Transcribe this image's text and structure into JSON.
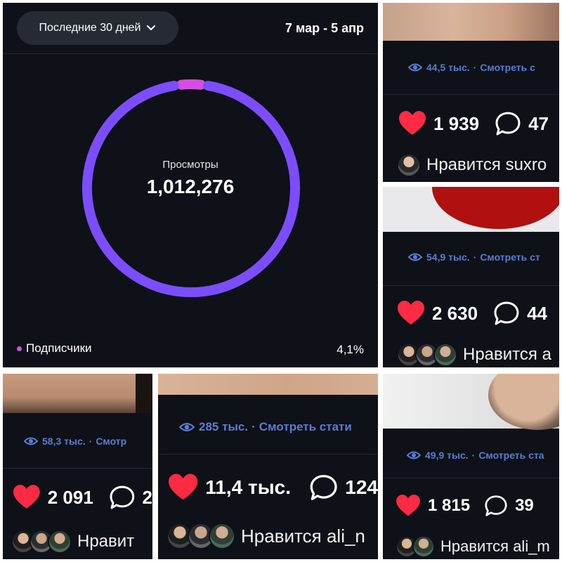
{
  "main": {
    "period_selector": "Последние 30 дней",
    "date_range": "7 мар - 5 апр",
    "ring_label": "Просмотры",
    "ring_value": "1,012,276",
    "legend_label": "Подписчики",
    "legend_percent": "4,1%",
    "colors": {
      "non_followers": "#7c4dff",
      "followers": "#d64de0"
    }
  },
  "chart_data": {
    "type": "pie",
    "categories": [
      "Подписчики",
      ""
    ],
    "values": [
      4.1,
      95.9
    ]
  },
  "posts": [
    {
      "views": "44,5 тыс.",
      "stats_link": "Смотреть с",
      "likes": "1 939",
      "comments": "47",
      "liked_by": "Нравится suxro"
    },
    {
      "views": "54,9 тыс.",
      "stats_link": "Смотреть ст",
      "likes": "2 630",
      "comments": "44",
      "liked_by": "Нравится а"
    },
    {
      "views": "58,3 тыс.",
      "stats_link": "Смотр",
      "likes": "2 091",
      "comments": "2",
      "liked_by": "Нравит"
    },
    {
      "views": "285 тыс.",
      "stats_link": "Смотреть стати",
      "likes": "11,4 тыс.",
      "comments": "124",
      "liked_by": "Нравится ali_n"
    },
    {
      "views": "49,9 тыс.",
      "stats_link": "Смотреть ста",
      "likes": "1 815",
      "comments": "39",
      "liked_by": "Нравится ali_m"
    }
  ],
  "icons": {
    "view": "eye-icon",
    "like": "heart-icon",
    "comment": "comment-icon",
    "dropdown": "chevron-down-icon"
  }
}
